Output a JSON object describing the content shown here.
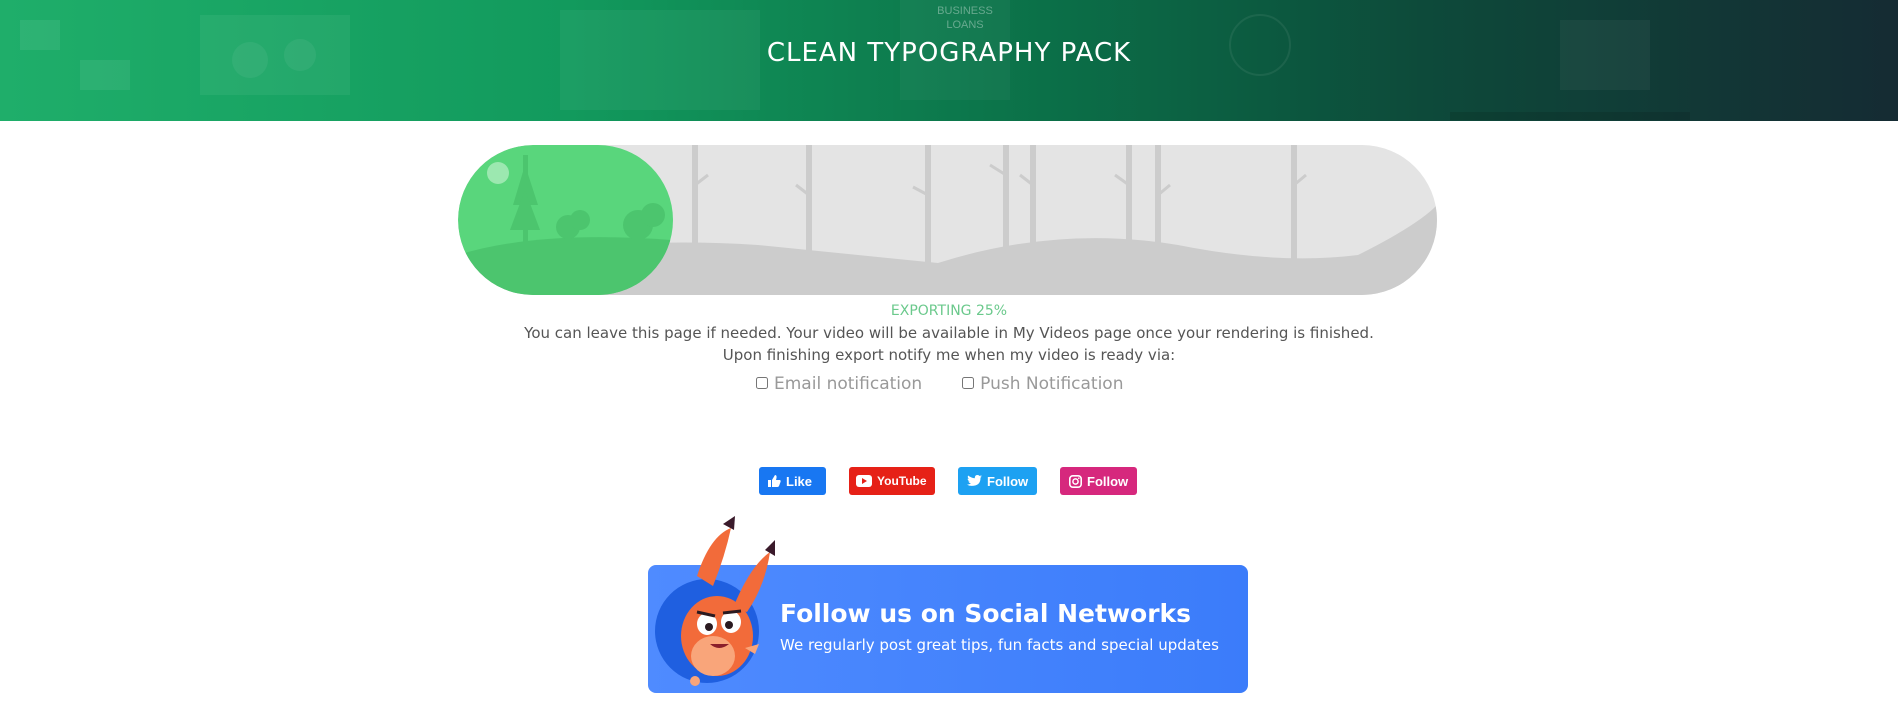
{
  "header": {
    "title": "CLEAN TYPOGRAPHY PACK",
    "background_text": "BUSINESS LOANS"
  },
  "export": {
    "status": "EXPORTING 25%",
    "progress_fraction": 0.22,
    "info_line": "You can leave this page if needed. Your video will be available in My Videos page once your rendering is finished.",
    "notify_prompt": "Upon finishing export notify me when my video is ready via:",
    "options": [
      {
        "label": "Email notification",
        "checked": false
      },
      {
        "label": "Push Notification",
        "checked": false
      }
    ]
  },
  "social": {
    "buttons": [
      {
        "label": "Like",
        "icon": "thumbs-up-icon",
        "color": "#1877f2"
      },
      {
        "label": "YouTube",
        "icon": "youtube-icon",
        "color": "#e62117"
      },
      {
        "label": "Follow",
        "icon": "twitter-icon",
        "color": "#1da1f2"
      },
      {
        "label": "Follow",
        "icon": "instagram-icon",
        "color": "#d6287d"
      }
    ]
  },
  "follow_card": {
    "title": "Follow us on Social Networks",
    "subtitle": "We regularly post great tips, fun facts and special updates"
  },
  "colors": {
    "progress_green": "#59d67c",
    "status_green": "#6bc98c",
    "card_blue": "#4f8bff",
    "mascot_orange": "#f26b3a"
  }
}
